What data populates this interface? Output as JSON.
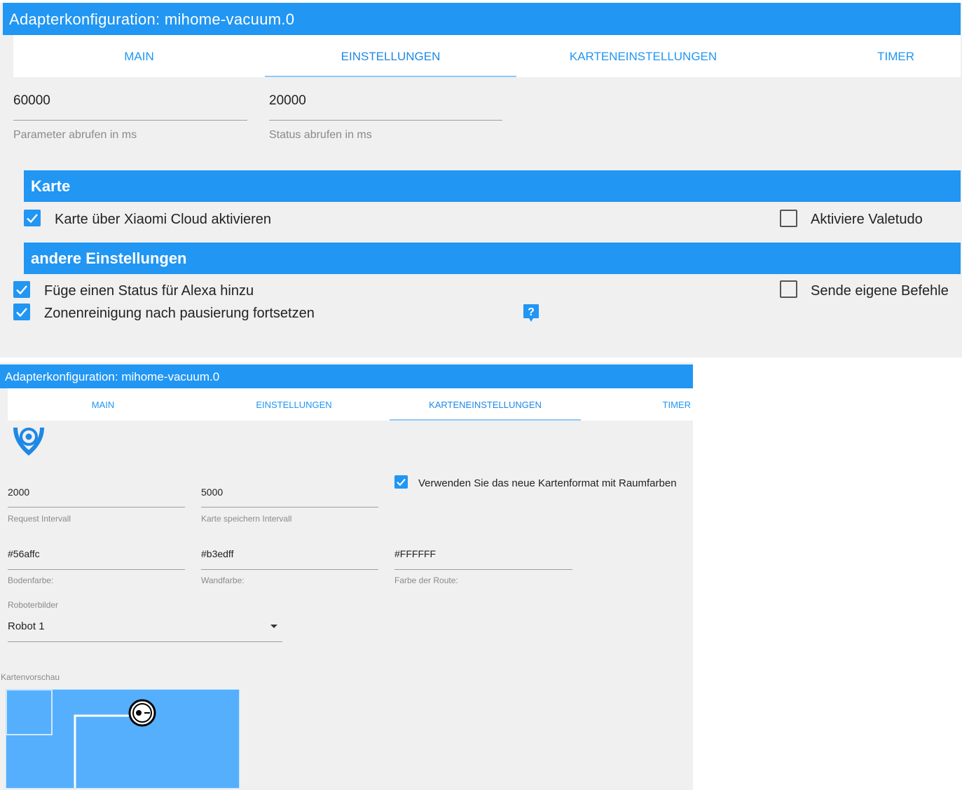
{
  "top": {
    "title": "Adapterkonfiguration: mihome-vacuum.0",
    "tabs": [
      "MAIN",
      "EINSTELLUNGEN",
      "KARTENEINSTELLUNGEN",
      "TIMER"
    ],
    "active_tab": "EINSTELLUNGEN",
    "fields": [
      {
        "value": "60000",
        "label": "Parameter abrufen in ms"
      },
      {
        "value": "20000",
        "label": "Status abrufen in ms"
      }
    ],
    "section_karte": "Karte",
    "cb_cloud": {
      "label": "Karte über Xiaomi Cloud aktivieren",
      "checked": true
    },
    "cb_valetudo": {
      "label": "Aktiviere Valetudo",
      "checked": false
    },
    "section_other": "andere Einstellungen",
    "cb_alexa": {
      "label": "Füge einen Status für Alexa hinzu",
      "checked": true
    },
    "cb_zone": {
      "label": "Zonenreinigung nach pausierung fortsetzen",
      "checked": true
    },
    "cb_commands": {
      "label": "Sende eigene Befehle",
      "checked": false
    },
    "help_icon": "question-icon"
  },
  "bottom": {
    "title": "Adapterkonfiguration: mihome-vacuum.0",
    "tabs": [
      "MAIN",
      "EINSTELLUNGEN",
      "KARTENEINSTELLUNGEN",
      "TIMER"
    ],
    "active_tab": "KARTENEINSTELLUNGEN",
    "logo_icon": "map-pin-logo-icon",
    "request_interval": {
      "value": "2000",
      "label": "Request Intervall"
    },
    "save_interval": {
      "value": "5000",
      "label": "Karte speichern Intervall"
    },
    "cb_newformat": {
      "label": "Verwenden Sie das neue Kartenformat mit Raumfarben",
      "checked": true
    },
    "floor_color": {
      "value": "#56affc",
      "label": "Bodenfarbe:"
    },
    "wall_color": {
      "value": "#b3edff",
      "label": "Wandfarbe:"
    },
    "route_color": {
      "value": "#FFFFFF",
      "label": "Farbe der Route:"
    },
    "robot_select": {
      "label": "Roboterbilder",
      "value": "Robot 1"
    },
    "preview_label": "Kartenvorschau"
  },
  "colors": {
    "accent": "#2196f3",
    "panel": "#f0f0f0",
    "map_floor": "#56affc"
  }
}
